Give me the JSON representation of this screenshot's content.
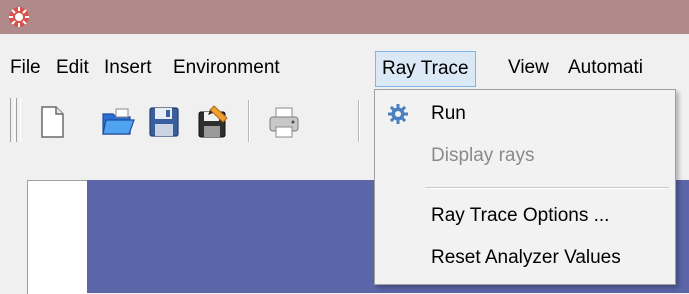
{
  "menubar": {
    "items": [
      {
        "label": "File"
      },
      {
        "label": "Edit"
      },
      {
        "label": "Insert"
      },
      {
        "label": "Environment"
      },
      {
        "label": "Ray Trace"
      },
      {
        "label": "View"
      },
      {
        "label": "Automati"
      }
    ]
  },
  "ray_trace_menu": {
    "items": [
      {
        "label": "Run",
        "enabled": true,
        "icon": "gear-icon"
      },
      {
        "label": "Display rays",
        "enabled": false
      },
      {
        "label": "Ray Trace Options ...",
        "enabled": true
      },
      {
        "label": "Reset Analyzer Values",
        "enabled": true
      }
    ]
  },
  "colors": {
    "titlebar": "#b08a8a",
    "menu_highlight": "#dbe9f7",
    "viewport_blue": "#5b66a8"
  }
}
